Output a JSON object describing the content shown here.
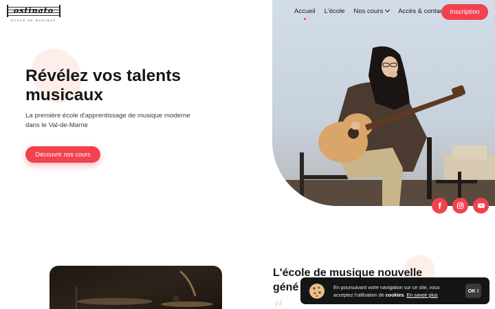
{
  "brand": {
    "logo_word": "ostinato",
    "logo_sub": "ÉCOLE DE MUSIQUE"
  },
  "nav": {
    "items": [
      {
        "label": "Accueil",
        "active": true
      },
      {
        "label": "L'école"
      },
      {
        "label": "Nos cours",
        "dropdown": true
      },
      {
        "label": "Accès & contact"
      }
    ],
    "cta_label": "Inscription"
  },
  "hero": {
    "title_line1": "Révélez vos talents",
    "title_line2": "musicaux",
    "subtitle": "La première école d'apprentissage de musique moderne dans le Val-de-Marne",
    "button_label": "Découvrir nos cours"
  },
  "social": [
    {
      "icon": "facebook-icon"
    },
    {
      "icon": "instagram-icon"
    },
    {
      "icon": "youtube-icon"
    }
  ],
  "section": {
    "title_line1": "L'école de musique nouvelle",
    "title_line2": "géné",
    "quote_mark": "“"
  },
  "cookie": {
    "text_before": "En poursuivant votre navigation sur ce site, vous acceptez l'utilisation de ",
    "text_bold": "cookies",
    "text_after": ". ",
    "link_label": "En savoir plus",
    "ok_label": "OK !"
  },
  "colors": {
    "accent": "#f2424f",
    "blob": "#fdeee9",
    "banner": "#151515"
  }
}
